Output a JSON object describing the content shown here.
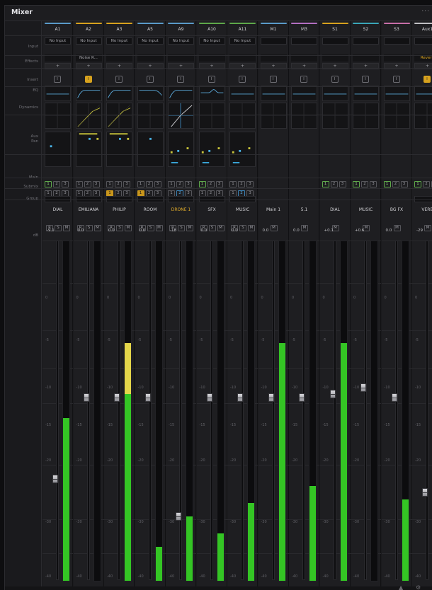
{
  "window": {
    "title": "Mixer",
    "more_label": "···"
  },
  "row_labels": {
    "input": "Input",
    "effects": "Effects",
    "insert": "Insert",
    "eq": "EQ",
    "dynamics": "Dynamics",
    "aux_pan": "Aux Pan",
    "main": "Main",
    "submix": "Submix",
    "group": "Group",
    "db": "dB"
  },
  "meter_scale": [
    "0",
    "-5",
    "-10",
    "-15",
    "-20",
    "-30",
    "-40",
    "-50"
  ],
  "colors": {
    "meter_green": "#34c524",
    "meter_yellow": "#e4d64a",
    "insert_active": "#d7a21e",
    "track_name_highlight": "#e1ad2a"
  },
  "channels": [
    {
      "id": "A1",
      "color": "#5a9ac9",
      "input": "No Input",
      "effect": "",
      "insert_active": false,
      "eq": "flat",
      "dynamics": "none",
      "aux_pan": "dot-left",
      "main": [
        1,
        2,
        3
      ],
      "submix": [
        1,
        2,
        3
      ],
      "main_on": [
        1
      ],
      "submix_on": [],
      "track": "DIAL",
      "track_highlight": false,
      "rsm": [
        "R",
        "S",
        "M"
      ],
      "db": "-9.1",
      "fader_level": 0.31,
      "meter_level": 0.48,
      "peak_level": 0.0
    },
    {
      "id": "A2",
      "color": "#d7a21e",
      "input": "No Input",
      "effect": "Noise R...",
      "insert_active": true,
      "eq": "highpass",
      "dynamics": "compressor",
      "aux_pan": "two-dots",
      "main": [
        1,
        2,
        3
      ],
      "submix": [
        1,
        2,
        3
      ],
      "main_on": [],
      "submix_on": [],
      "track": "EMILIANA",
      "track_highlight": false,
      "rsm": [
        "R",
        "S",
        "M"
      ],
      "db": "0.0",
      "fader_level": 0.55,
      "meter_level": 0.0,
      "peak_level": 0.0
    },
    {
      "id": "A3",
      "color": "#d7a21e",
      "input": "No Input",
      "effect": "",
      "insert_active": false,
      "eq": "highpass",
      "dynamics": "compressor",
      "aux_pan": "two-dots",
      "main": [
        1,
        2,
        3
      ],
      "submix": [
        1,
        2,
        3
      ],
      "main_on": [],
      "submix_on": [
        1
      ],
      "track": "PHILIP",
      "track_highlight": false,
      "rsm": [
        "R",
        "S",
        "M"
      ],
      "db": "0.0",
      "fader_level": 0.55,
      "meter_level": 0.55,
      "peak_level": 0.7
    },
    {
      "id": "A5",
      "color": "#5a9ac9",
      "input": "No Input",
      "effect": "",
      "insert_active": false,
      "eq": "lowpass",
      "dynamics": "none",
      "aux_pan": "dot-center",
      "main": [
        1,
        2,
        3
      ],
      "submix": [
        1,
        2,
        3
      ],
      "main_on": [],
      "submix_on": [
        1
      ],
      "track": "ROOM",
      "track_highlight": false,
      "rsm": [
        "R",
        "S",
        "M"
      ],
      "db": "0.0",
      "fader_level": 0.55,
      "meter_level": 0.1,
      "peak_level": 0.0
    },
    {
      "id": "A9",
      "color": "#5a9ac9",
      "input": "No Input",
      "effect": "",
      "insert_active": false,
      "eq": "highpass",
      "dynamics": "gate",
      "aux_pan": "spread",
      "main": [
        1,
        2,
        3
      ],
      "submix": [
        1,
        2,
        3
      ],
      "main_on": [],
      "submix_on": [
        2
      ],
      "track": "DRONE 1",
      "track_highlight": true,
      "rsm": [
        "R",
        "S",
        "M"
      ],
      "db": "-18",
      "fader_level": 0.2,
      "meter_level": 0.19,
      "peak_level": 0.0
    },
    {
      "id": "A10",
      "color": "#5ea84a",
      "input": "No Input",
      "effect": "",
      "insert_active": false,
      "eq": "bump",
      "dynamics": "none",
      "aux_pan": "spread",
      "main": [
        1,
        2,
        3
      ],
      "submix": [
        1,
        2,
        3
      ],
      "main_on": [
        1
      ],
      "submix_on": [],
      "track": "SFX",
      "track_highlight": false,
      "rsm": [
        "R",
        "S",
        "M"
      ],
      "db": "0.0",
      "fader_level": 0.55,
      "meter_level": 0.14,
      "peak_level": 0.0
    },
    {
      "id": "A11",
      "color": "#5ea84a",
      "input": "No Input",
      "effect": "",
      "insert_active": false,
      "eq": "flat",
      "dynamics": "none",
      "aux_pan": "spread",
      "main": [
        1,
        2,
        3
      ],
      "submix": [
        1,
        2,
        3
      ],
      "main_on": [],
      "submix_on": [
        2
      ],
      "track": "MUSIC",
      "track_highlight": false,
      "rsm": [
        "R",
        "S",
        "M"
      ],
      "db": "0.0",
      "fader_level": 0.55,
      "meter_level": 0.23,
      "peak_level": 0.0
    },
    {
      "id": "M1",
      "color": "#5a9ac9",
      "input": "",
      "effect": "",
      "insert_active": false,
      "eq": "flat",
      "dynamics": "none",
      "aux_pan": "blank",
      "main": [],
      "submix": [],
      "main_on": [],
      "submix_on": [],
      "track": "Main 1",
      "track_highlight": false,
      "rsm": [
        "M"
      ],
      "db": "0.0",
      "fader_level": 0.55,
      "meter_level": 0.7,
      "peak_level": 0.0
    },
    {
      "id": "M3",
      "color": "#b36fc2",
      "input": "",
      "effect": "",
      "insert_active": false,
      "eq": "flat",
      "dynamics": "none",
      "aux_pan": "blank",
      "main": [],
      "submix": [],
      "main_on": [],
      "submix_on": [],
      "track": "5.1",
      "track_highlight": false,
      "rsm": [
        "M"
      ],
      "db": "0.0",
      "fader_level": 0.55,
      "meter_level": 0.28,
      "peak_level": 0.0
    },
    {
      "id": "S1",
      "color": "#d7a21e",
      "input": "",
      "effect": "",
      "insert_active": false,
      "eq": "flat",
      "dynamics": "none",
      "aux_pan": "blank",
      "main": [
        1,
        2,
        3
      ],
      "submix": [],
      "main_on": [
        1
      ],
      "submix_on": [],
      "track": "DIAL",
      "track_highlight": false,
      "rsm": [
        "M"
      ],
      "db": "+0.1",
      "fader_level": 0.56,
      "meter_level": 0.7,
      "peak_level": 0.0
    },
    {
      "id": "S2",
      "color": "#3aa6b8",
      "input": "",
      "effect": "",
      "insert_active": false,
      "eq": "flat",
      "dynamics": "none",
      "aux_pan": "blank",
      "main": [
        1,
        2,
        3
      ],
      "submix": [],
      "main_on": [
        1
      ],
      "submix_on": [],
      "track": "MUSIC",
      "track_highlight": false,
      "rsm": [
        "M"
      ],
      "db": "+0.6",
      "fader_level": 0.58,
      "meter_level": 0.0,
      "peak_level": 0.0
    },
    {
      "id": "S3",
      "color": "#c86fa8",
      "input": "",
      "effect": "",
      "insert_active": false,
      "eq": "flat",
      "dynamics": "none",
      "aux_pan": "blank",
      "main": [
        1,
        2,
        3
      ],
      "submix": [],
      "main_on": [
        1
      ],
      "submix_on": [],
      "track": "BG FX",
      "track_highlight": false,
      "rsm": [
        "M"
      ],
      "db": "0.0",
      "fader_level": 0.55,
      "meter_level": 0.24,
      "peak_level": 0.0
    },
    {
      "id": "Aux1",
      "color": "#c0c0c4",
      "input": "",
      "effect": "Reverb",
      "insert_active": true,
      "eq": "flat",
      "dynamics": "none",
      "aux_pan": "blank",
      "main": [
        1,
        2,
        3
      ],
      "submix": [],
      "main_on": [
        1
      ],
      "submix_on": [],
      "track": "VERB",
      "track_highlight": false,
      "rsm": [
        "M"
      ],
      "db": "-29",
      "fader_level": 0.27,
      "meter_level": 0.12,
      "peak_level": 0.0
    }
  ]
}
